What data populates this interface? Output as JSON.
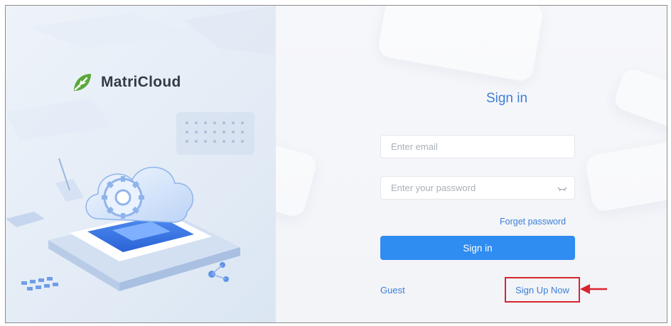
{
  "brand": {
    "name": "MatriCloud",
    "logo_color": "#5aa83a"
  },
  "form": {
    "title": "Sign in",
    "email_placeholder": "Enter email",
    "password_placeholder": "Enter your password",
    "password_toggle_icon": "eye-closed-icon",
    "forget_password": "Forget password",
    "sign_in_button": "Sign in",
    "guest_link": "Guest",
    "sign_up_link": "Sign Up Now"
  },
  "annotation": {
    "highlight_color": "#d9242f",
    "arrow_icon": "left-arrow-icon"
  },
  "colors": {
    "accent": "#2f8cf0",
    "link": "#3d7fd6"
  }
}
